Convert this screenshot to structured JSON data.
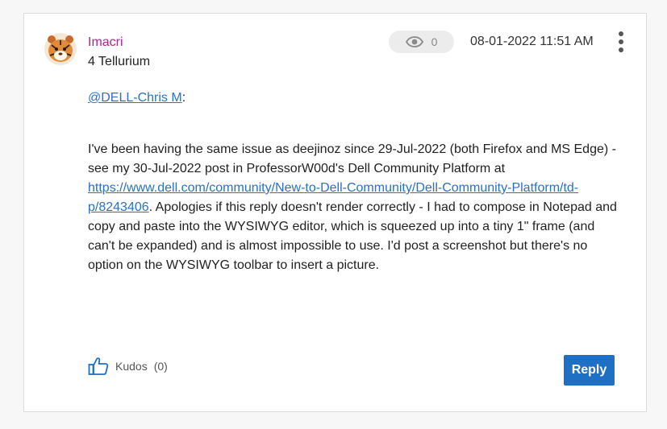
{
  "author": {
    "name": "Imacri",
    "rank": "4 Tellurium"
  },
  "views": {
    "count": "0",
    "icon": "eye-icon"
  },
  "post": {
    "date": "08-01-2022 11:51 AM",
    "mention_link": "@DELL-Chris M",
    "mention_suffix": ":",
    "body_part1": "I've been having the same issue as deejinoz since 29-Jul-2022 (both Firefox and MS Edge) - see my 30-Jul-2022 post in ProfessorW00d's Dell Community Platform at ",
    "body_link": "https://www.dell.com/community/New-to-Dell-Community/Dell-Community-Platform/td-p/8243406",
    "body_part2": ". Apologies if this reply doesn't render correctly - I had to compose in Notepad and copy and paste into the WYSIWYG editor, which is squeezed up into a tiny 1\" frame (and can't be expanded) and is almost impossible to use. I'd post a screenshot but there's no option on the WYSIWYG toolbar to insert a picture."
  },
  "footer": {
    "kudos_label": "Kudos",
    "kudos_count": "(0)",
    "reply_label": "Reply"
  },
  "colors": {
    "author_name": "#c01a9c",
    "link": "#2e6ec6",
    "reply_button": "#1f6fc5",
    "card_border": "#dcdcdc"
  }
}
